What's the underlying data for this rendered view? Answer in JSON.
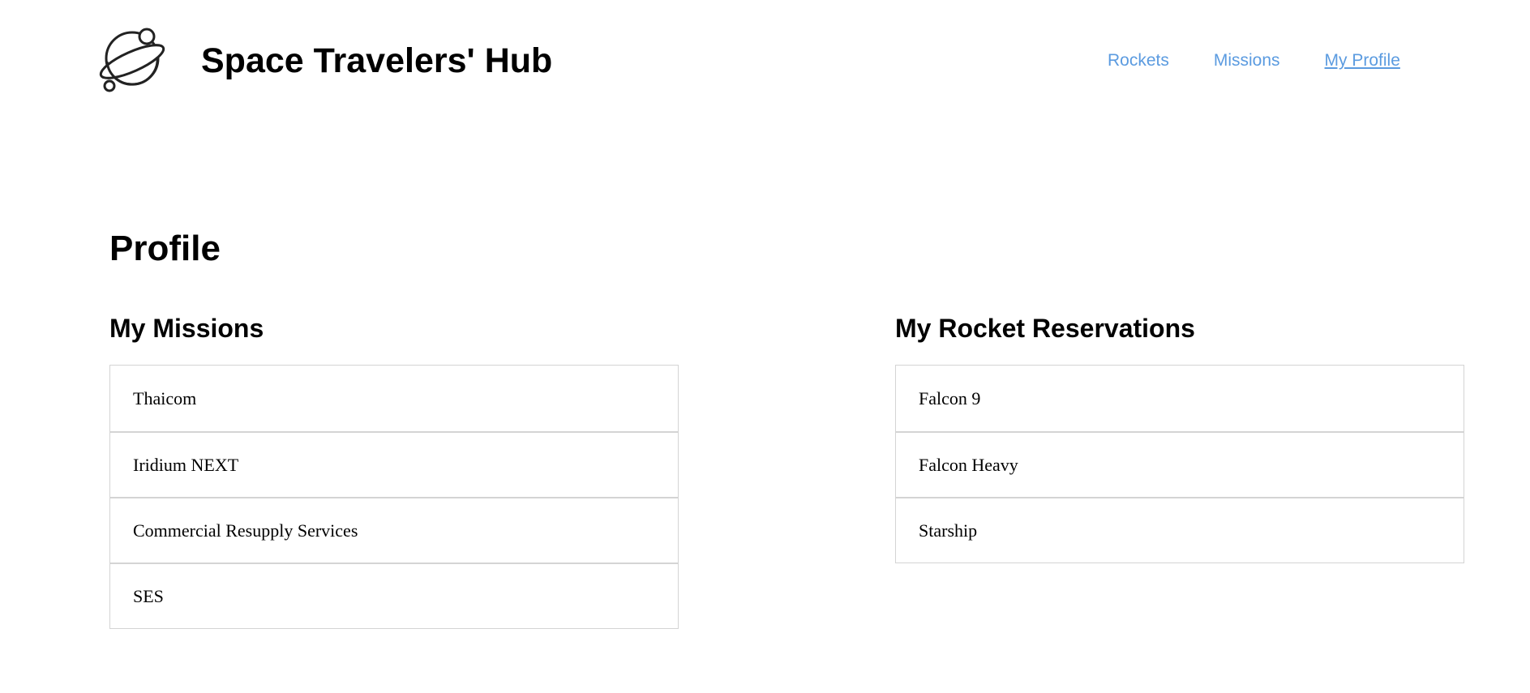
{
  "header": {
    "logo_icon": "planet-icon",
    "title": "Space Travelers' Hub",
    "nav": [
      {
        "label": "Rockets",
        "active": false
      },
      {
        "label": "Missions",
        "active": false
      },
      {
        "label": "My Profile",
        "active": true
      }
    ]
  },
  "colors": {
    "nav_link": "#5b9be0",
    "list_border": "#d4d4d4"
  },
  "profile": {
    "title": "Profile",
    "missions": {
      "heading": "My Missions",
      "items": [
        "Thaicom",
        "Iridium NEXT",
        "Commercial Resupply Services",
        "SES"
      ]
    },
    "rockets": {
      "heading": "My Rocket Reservations",
      "items": [
        "Falcon 9",
        "Falcon Heavy",
        "Starship"
      ]
    }
  }
}
